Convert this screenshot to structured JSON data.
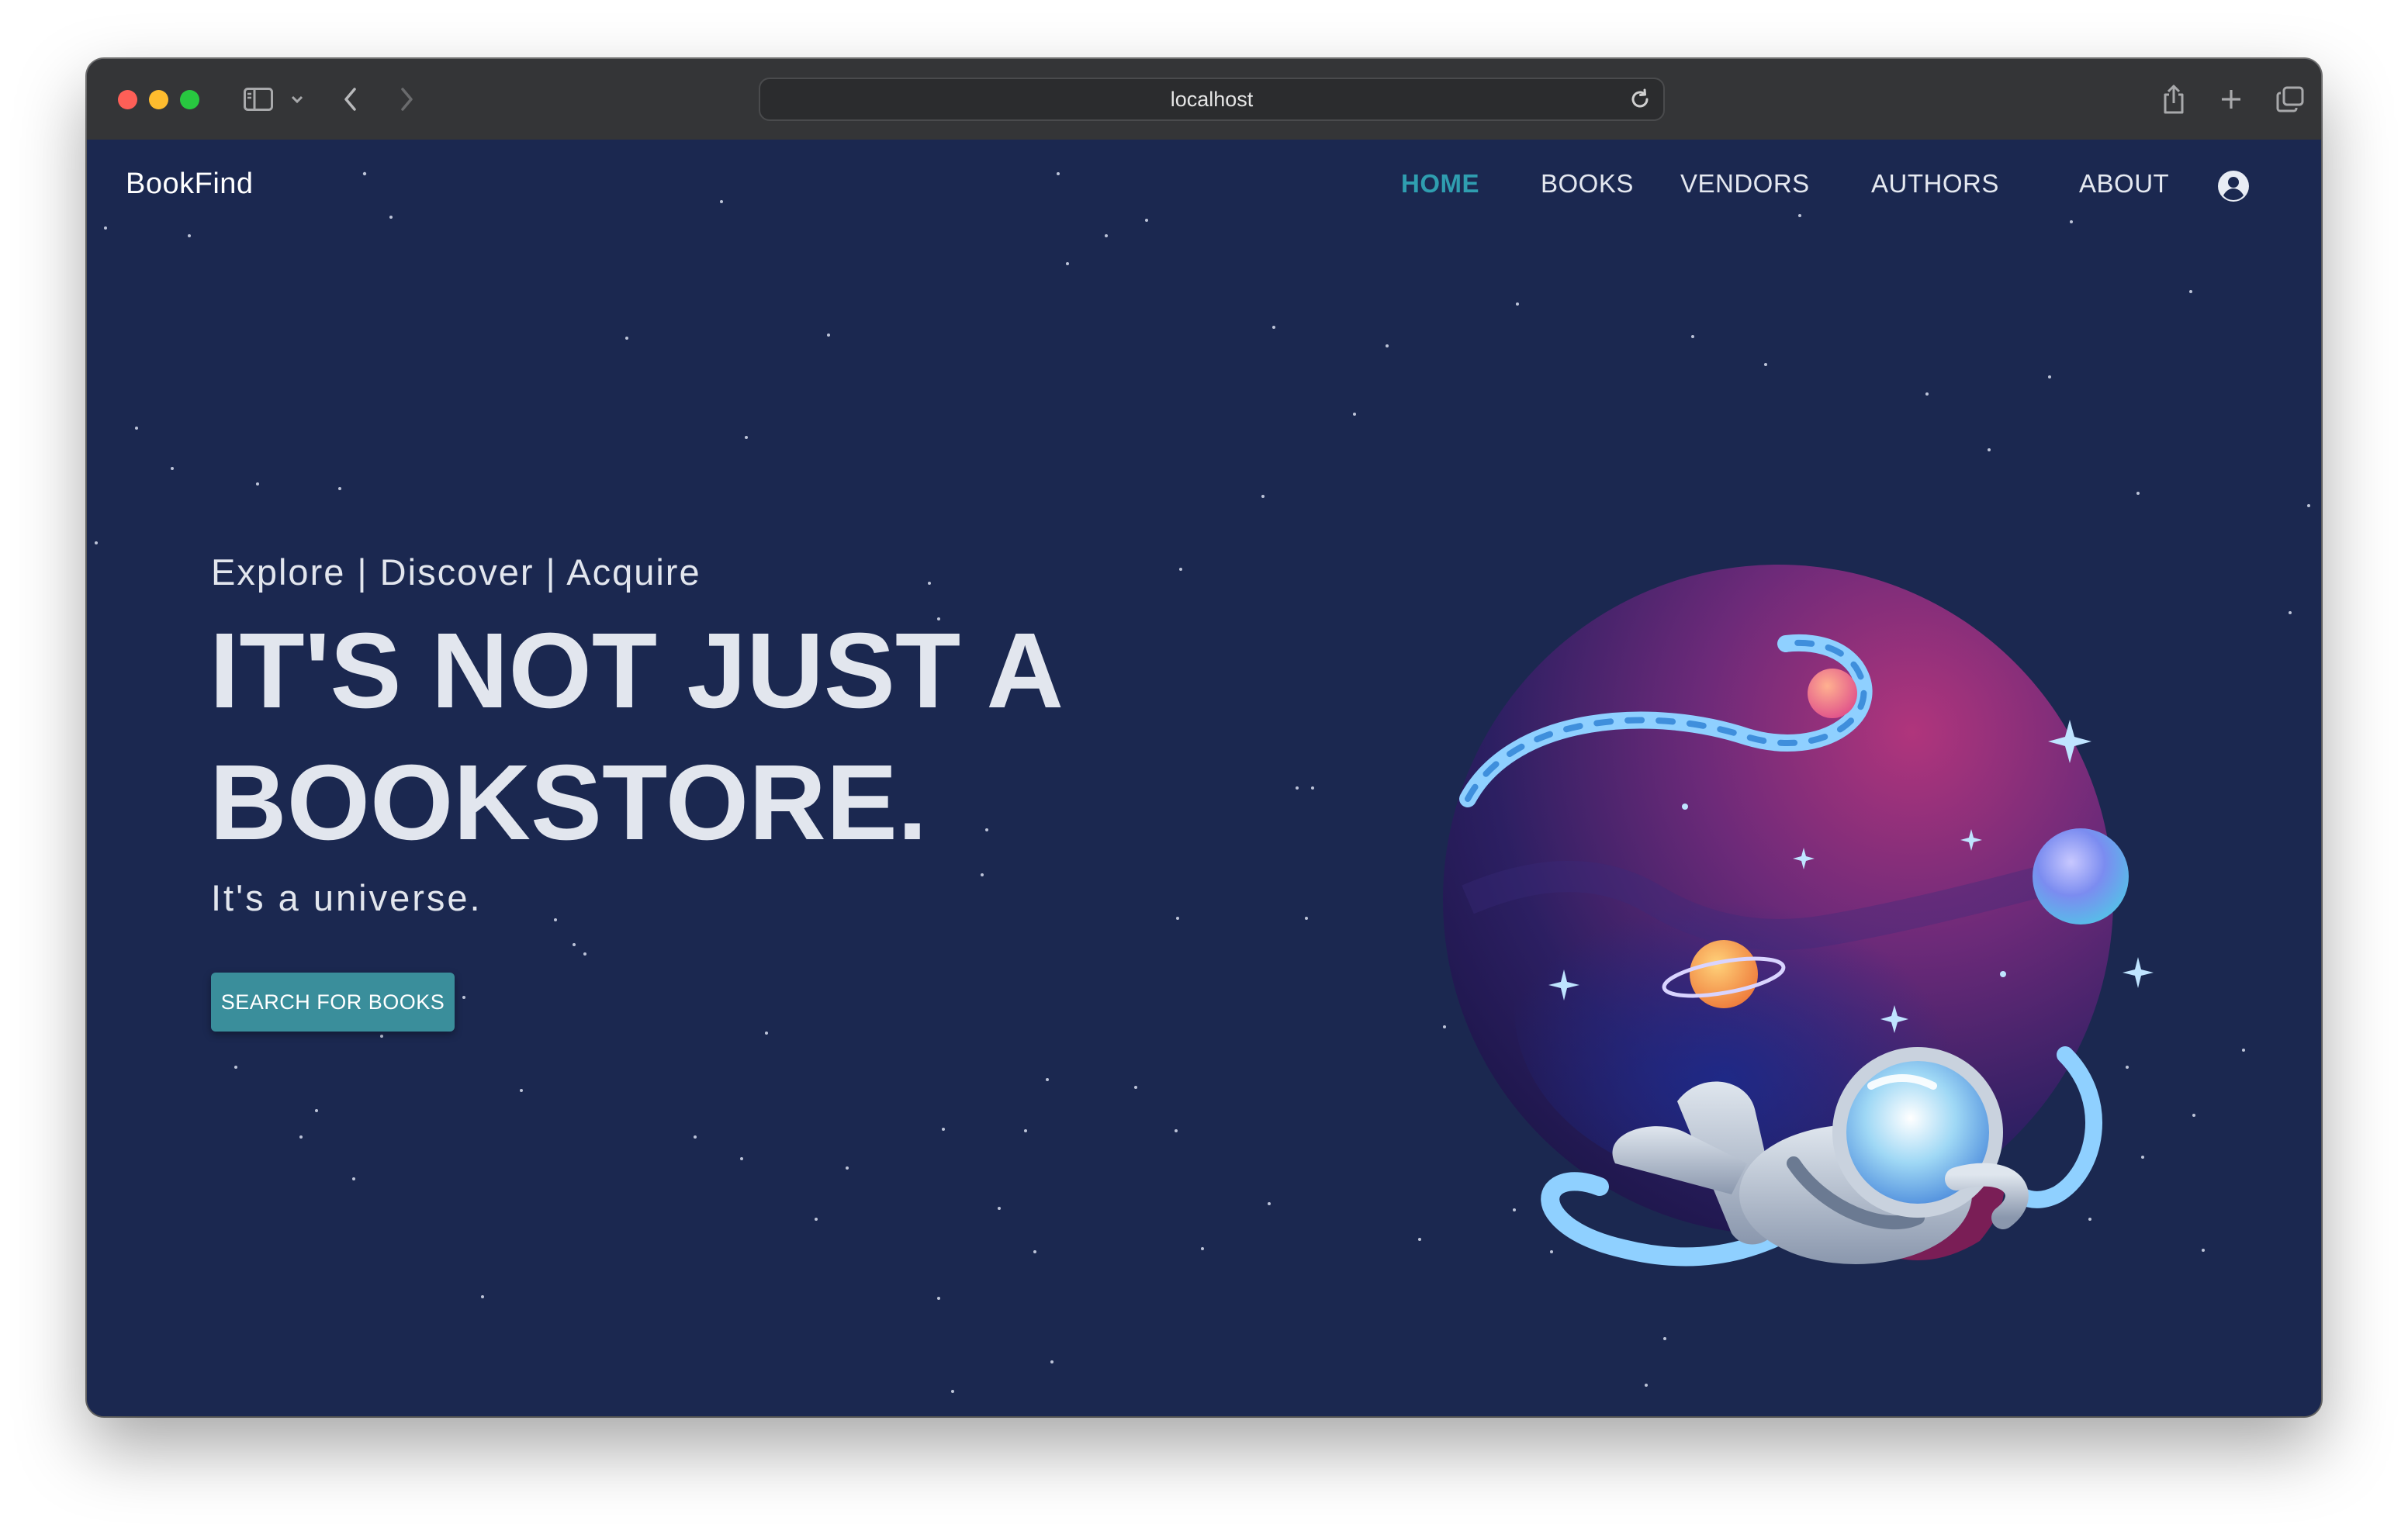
{
  "browser": {
    "url": "localhost",
    "icons": [
      "sidebar-icon",
      "chevron-down-icon",
      "back-arrow-icon",
      "forward-arrow-icon",
      "reload-icon",
      "share-icon",
      "plus-icon",
      "tabs-overview-icon"
    ]
  },
  "navbar": {
    "brand": "BookFind",
    "links": [
      {
        "label": "HOME",
        "active": true
      },
      {
        "label": "BOOKS",
        "active": false
      },
      {
        "label": "VENDORS",
        "active": false
      },
      {
        "label": "AUTHORS",
        "active": false
      },
      {
        "label": "ABOUT",
        "active": false
      }
    ],
    "account_icon": "account-circle-icon"
  },
  "hero": {
    "tagline": "Explore | Discover | Acquire",
    "headline_line1": "IT'S NOT JUST A",
    "headline_line2": "BOOKSTORE.",
    "subline": "It's a universe.",
    "cta_label": "SEARCH FOR BOOKS",
    "illustration": "astronaut-in-space-sphere-illustration"
  },
  "colors": {
    "background": "#1b2850",
    "accent": "#2f9eb0",
    "button": "#3a8e9b",
    "text": "#e2e6ee"
  }
}
